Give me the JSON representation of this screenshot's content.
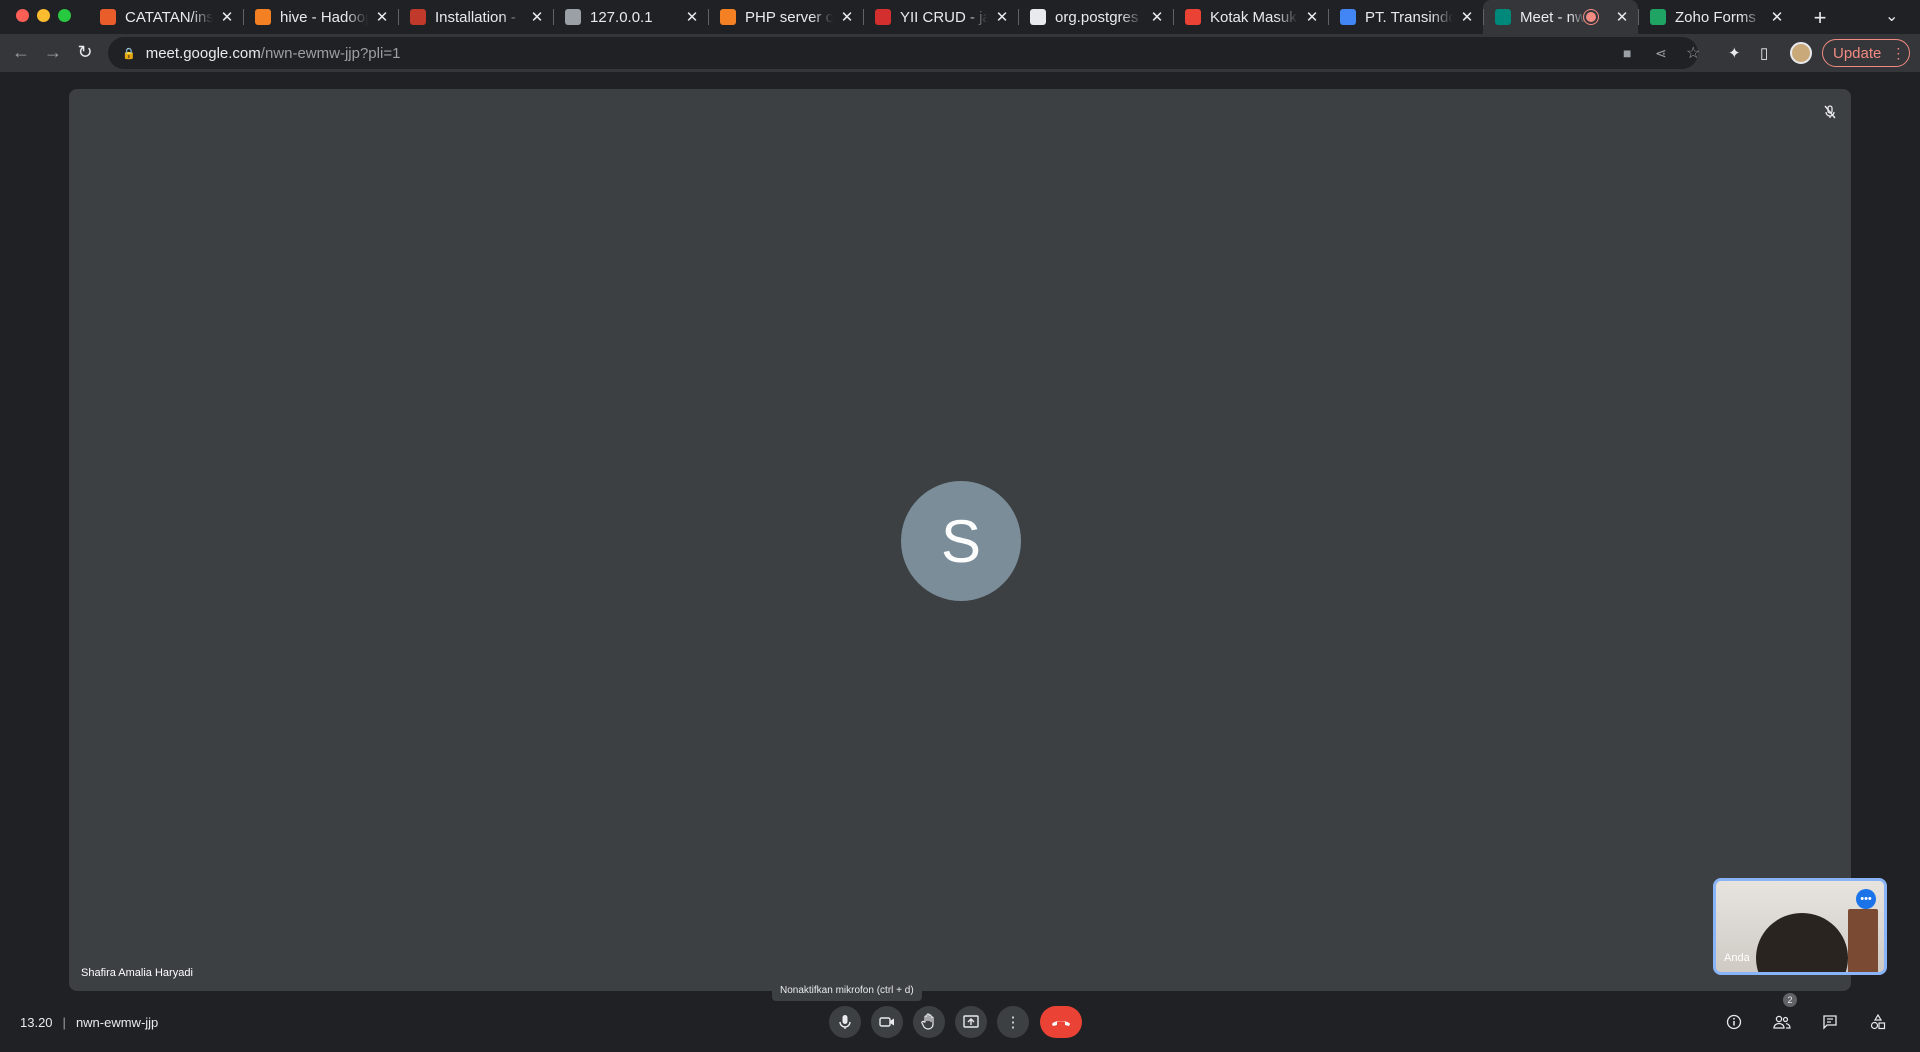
{
  "browser": {
    "tabs": [
      {
        "title": "CATATAN/ins",
        "favicon": "git-logo-icon",
        "fav_color": "#e85d2a",
        "active": false
      },
      {
        "title": "hive - Hadoop",
        "favicon": "stackoverflow-icon",
        "fav_color": "#f48024",
        "active": false
      },
      {
        "title": "Installation - ",
        "favicon": "yii-icon",
        "fav_color": "#c0392b",
        "active": false
      },
      {
        "title": "127.0.0.1",
        "favicon": "globe-icon",
        "fav_color": "#9aa0a6",
        "active": false
      },
      {
        "title": "PHP server or",
        "favicon": "stackoverflow-icon",
        "fav_color": "#f48024",
        "active": false
      },
      {
        "title": "YII CRUD - jav",
        "favicon": "yii-icon",
        "fav_color": "#d32f2f",
        "active": false
      },
      {
        "title": "org.postgres",
        "favicon": "github-icon",
        "fav_color": "#e8eaed",
        "active": false
      },
      {
        "title": "Kotak Masuk",
        "favicon": "gmail-icon",
        "fav_color": "#ea4335",
        "active": false
      },
      {
        "title": "PT. Transindo",
        "favicon": "google-icon",
        "fav_color": "#4285f4",
        "active": false
      },
      {
        "title": "Meet - nw",
        "favicon": "meet-icon",
        "fav_color": "#00897b",
        "active": true
      },
      {
        "title": "Zoho Forms",
        "favicon": "zoho-forms-icon",
        "fav_color": "#1fa463",
        "active": false
      }
    ],
    "url_host": "meet.google.com",
    "url_path": "/nwn-ewmw-jjp?pli=1",
    "update_label": "Update"
  },
  "meet": {
    "participant_initial": "S",
    "participant_name": "Shafira Amalia Haryadi",
    "self_label": "Anda",
    "tooltip": "Nonaktifkan mikrofon (ctrl + d)",
    "time": "13.20",
    "separator": "|",
    "meeting_code": "nwn-ewmw-jjp",
    "participant_count": "2"
  },
  "colors": {
    "accent": "#8ab4f8",
    "end_call": "#ea4335",
    "tile_bg": "#3c4043",
    "avatar_bg": "#7a8d99"
  }
}
